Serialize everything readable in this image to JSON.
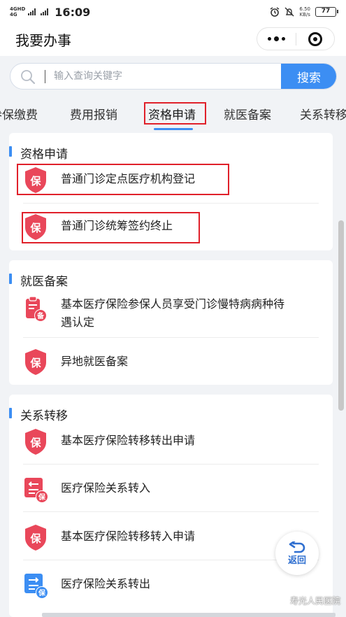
{
  "status_bar": {
    "network_top": "4GHD",
    "network_bottom": "4G",
    "time": "16:09",
    "speed_value": "6.50",
    "speed_unit": "KB/s",
    "battery": "77"
  },
  "header": {
    "title": "我要办事"
  },
  "search": {
    "placeholder": "输入查询关键字",
    "button_label": "搜索"
  },
  "tabs": [
    {
      "label": "参保缴费"
    },
    {
      "label": "费用报销"
    },
    {
      "label": "资格申请",
      "active": true
    },
    {
      "label": "就医备案"
    },
    {
      "label": "关系转移"
    }
  ],
  "sections": [
    {
      "title": "资格申请",
      "items": [
        {
          "label": "普通门诊定点医疗机构登记",
          "icon": "shield-bao-icon"
        },
        {
          "label": "普通门诊统筹签约终止",
          "icon": "shield-bao-icon"
        }
      ]
    },
    {
      "title": "就医备案",
      "items": [
        {
          "label_line1": "基本医疗保险参保人员享受门诊慢特病病种待",
          "label_line2": "遇认定",
          "icon": "clipboard-bei-icon"
        },
        {
          "label": "异地就医备案",
          "icon": "shield-bao-icon"
        }
      ]
    },
    {
      "title": "关系转移",
      "items": [
        {
          "label": "基本医疗保险转移转出申请",
          "icon": "shield-bao-icon"
        },
        {
          "label": "医疗保险关系转入",
          "icon": "transfer-in-icon"
        },
        {
          "label": "基本医疗保险转移转入申请",
          "icon": "shield-bao-icon"
        },
        {
          "label": "医疗保险关系转出",
          "icon": "transfer-out-icon"
        }
      ]
    }
  ],
  "glyphs": {
    "bao": "保",
    "bei": "备"
  },
  "back_button": {
    "label": "返回"
  },
  "watermark": {
    "text": "寿光人民医院"
  },
  "colors": {
    "accent_blue": "#3c8ef3",
    "icon_red": "#e9475a",
    "highlight_red": "#e0202a"
  }
}
